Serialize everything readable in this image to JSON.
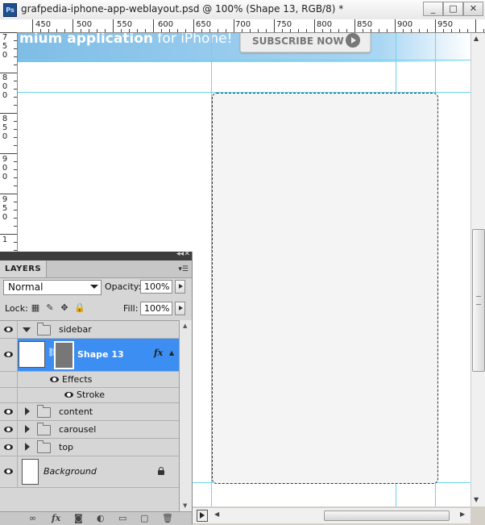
{
  "titlebar": {
    "app_icon": "Ps",
    "title": "grafpedia-iphone-app-weblayout.psd @ 100% (Shape 13, RGB/8) *",
    "minimize_label": "_",
    "maximize_label": "□",
    "close_label": "✕"
  },
  "ruler": {
    "top_labels": [
      "450",
      "500",
      "550",
      "600",
      "650",
      "700",
      "750",
      "800",
      "850",
      "900",
      "950"
    ],
    "left_labels": [
      [
        "7",
        "5",
        "0"
      ],
      [
        "8",
        "0",
        "0"
      ],
      [
        "8",
        "5",
        "0"
      ],
      [
        "9",
        "0",
        "0"
      ],
      [
        "9",
        "5",
        "0"
      ],
      [
        "1"
      ]
    ]
  },
  "canvas": {
    "banner_text_bold": "mium application",
    "banner_text_lite": " for iPhone!",
    "subscribe_label": "SUBSCRIBE NOW"
  },
  "layers_panel": {
    "tab_label": "LAYERS",
    "collapse_icon": "◂◂",
    "close_icon": "✕",
    "menu_icon": "▾☰",
    "blend_mode": "Normal",
    "opacity_label": "Opacity:",
    "opacity_value": "100%",
    "lock_label": "Lock:",
    "fill_label": "Fill:",
    "fill_value": "100%",
    "layers": {
      "sidebar": "sidebar",
      "shape13": "Shape 13",
      "effects": "Effects",
      "stroke": "Stroke",
      "content": "content",
      "carousel": "carousel",
      "top": "top",
      "background": "Background"
    },
    "fx_label": "fx",
    "bottom_icons": [
      "link-icon",
      "fx-icon",
      "mask-icon",
      "adjustment-icon",
      "folder-icon",
      "new-layer-icon",
      "trash-icon"
    ]
  },
  "colors": {
    "selection": "#3c8ef2",
    "guide": "#6ad4ef",
    "panel_bg": "#d6d6d6"
  }
}
